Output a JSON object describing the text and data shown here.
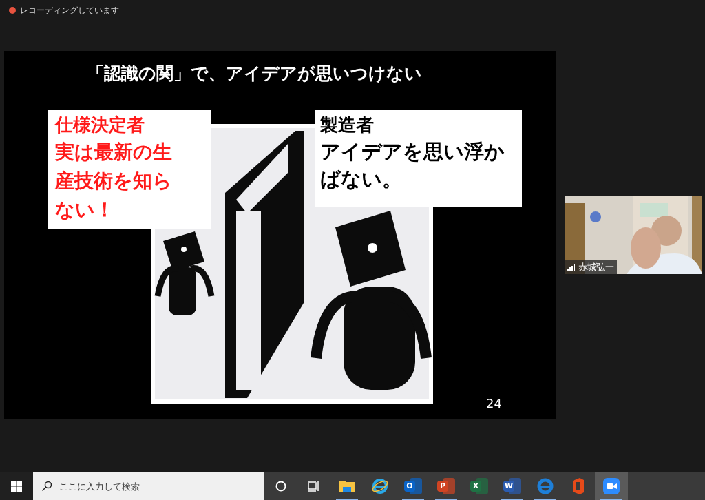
{
  "recording": {
    "label": "レコーディングしています",
    "on": true
  },
  "slide": {
    "title": "「認識の関」で、アイデアが思いつけない",
    "left_box": {
      "heading": "仕様決定者",
      "body": "実は最新の生産技術を知らない！"
    },
    "right_box": {
      "heading": "製造者",
      "body": "アイデアを思い浮かばない。"
    },
    "page_number": "24"
  },
  "video_tile": {
    "kind": "picture",
    "name": "赤城弘一"
  },
  "taskbar": {
    "search": {
      "placeholder": "ここに入力して検索"
    },
    "apps": [
      {
        "kind": "explorer",
        "running": true,
        "selected": false
      },
      {
        "kind": "ie",
        "running": false,
        "selected": false
      },
      {
        "kind": "outlook",
        "glyph": "O",
        "running": true,
        "selected": false
      },
      {
        "kind": "powerpoint",
        "glyph": "P",
        "running": true,
        "selected": false
      },
      {
        "kind": "excel",
        "glyph": "X",
        "running": false,
        "selected": false
      },
      {
        "kind": "word",
        "glyph": "W",
        "running": true,
        "selected": false
      },
      {
        "kind": "edge",
        "running": true,
        "selected": false
      },
      {
        "kind": "office",
        "running": false,
        "selected": false
      },
      {
        "kind": "zoom",
        "running": true,
        "selected": true
      }
    ]
  }
}
